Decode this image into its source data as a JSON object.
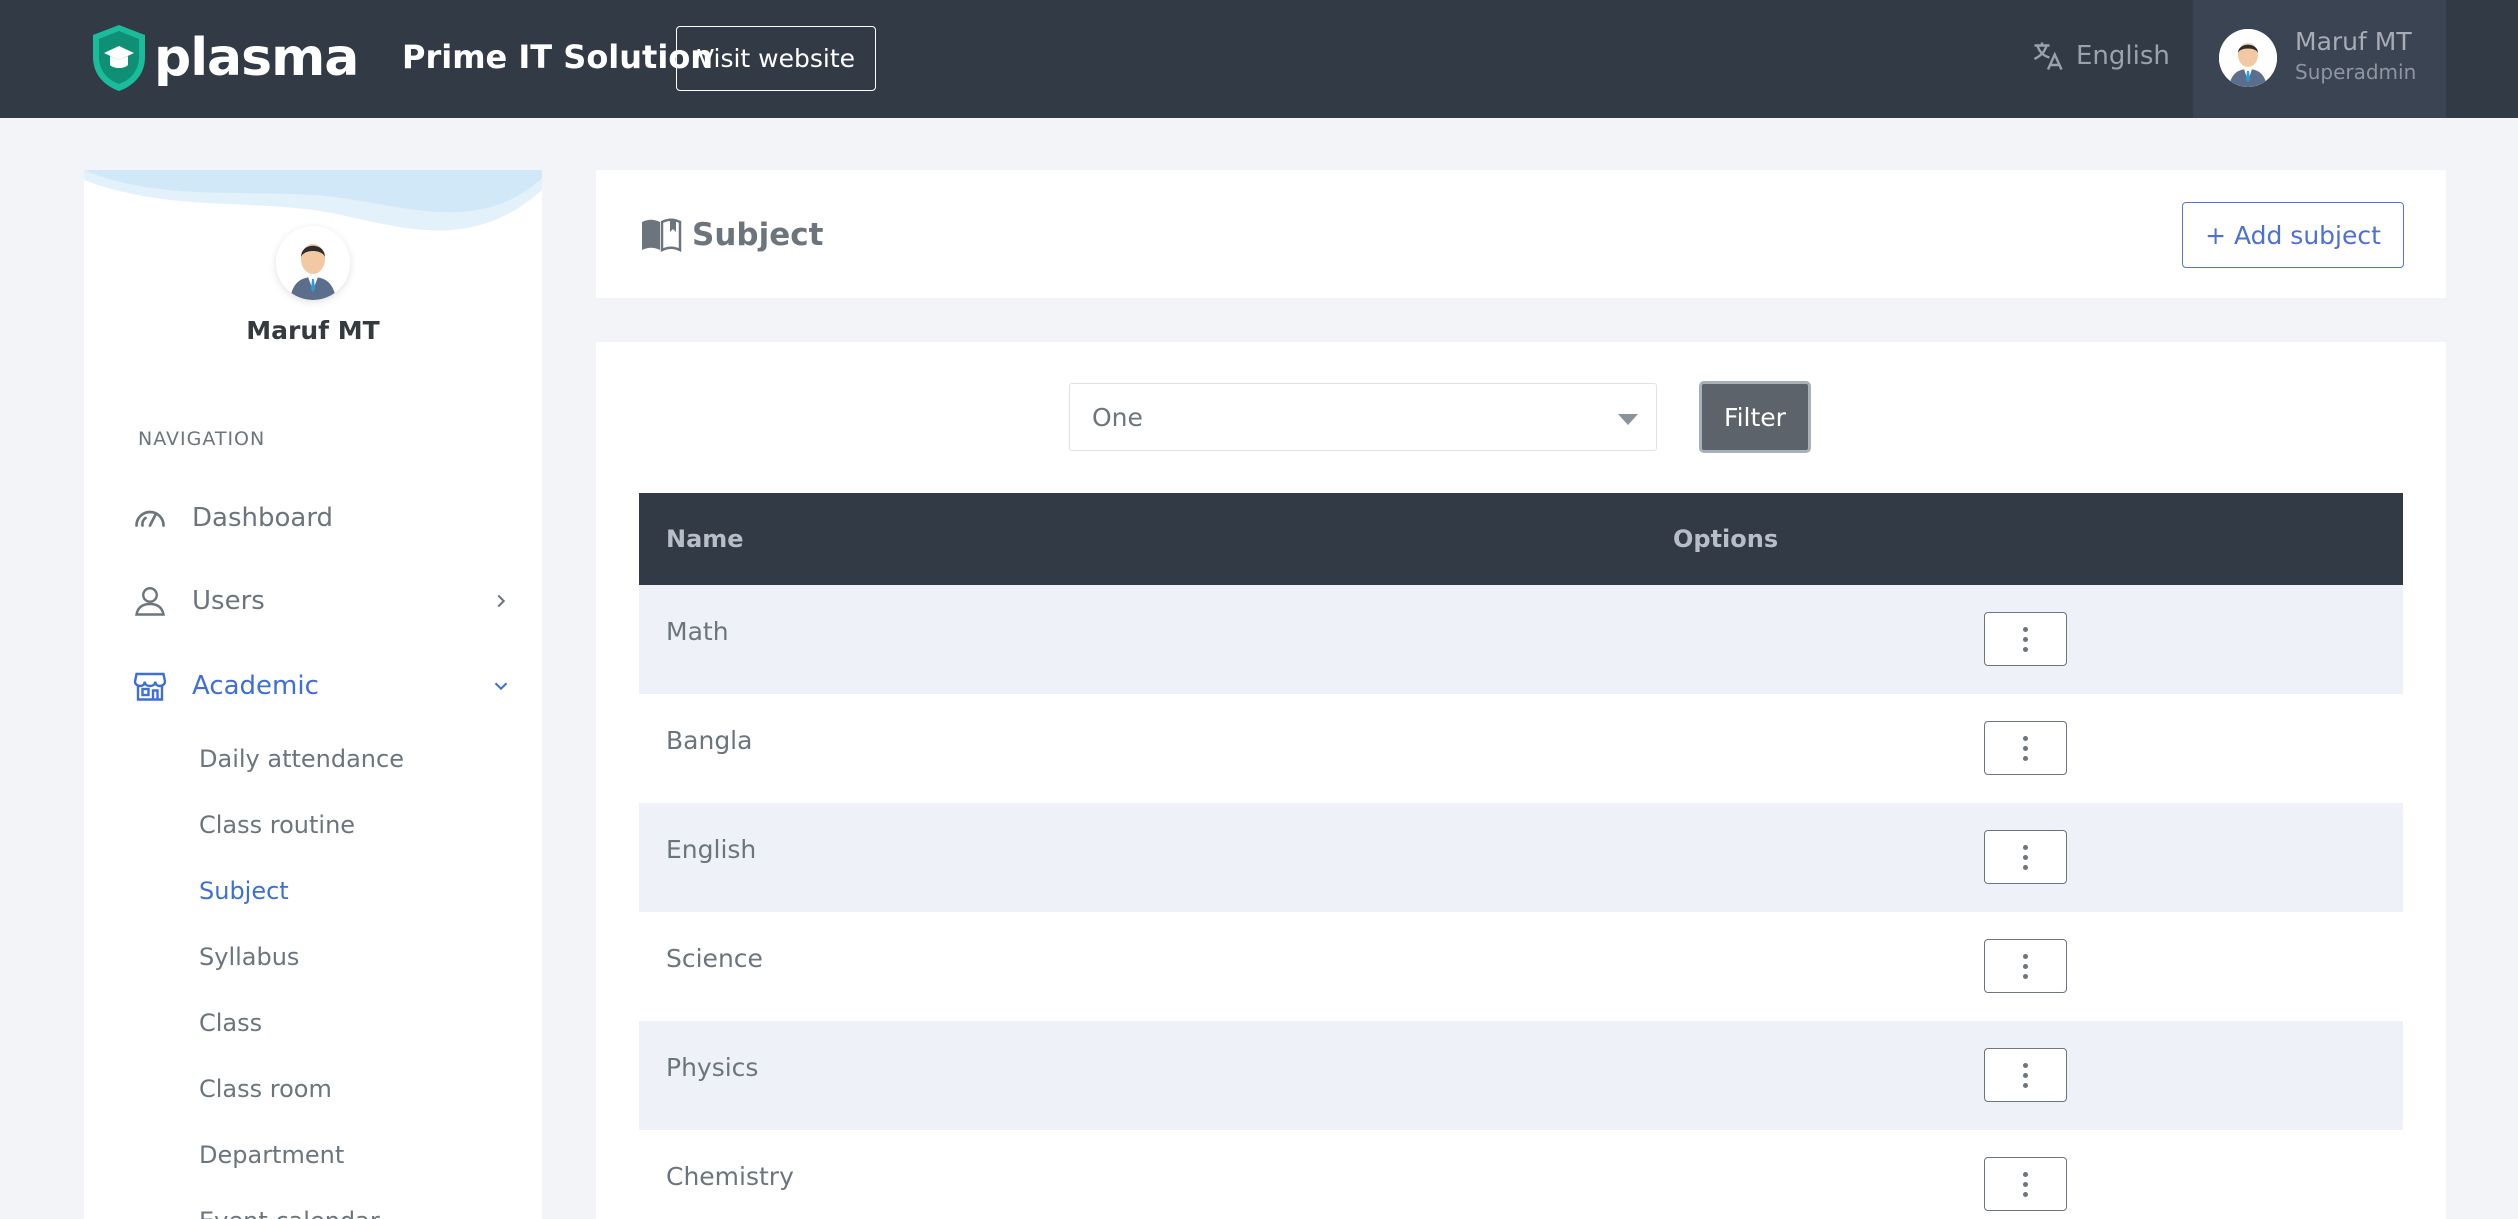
{
  "header": {
    "logo_text": "plasma",
    "org_name": "Prime IT Solution",
    "visit_label": "Visit website",
    "language": "English",
    "user_name": "Maruf MT",
    "user_role": "Superadmin"
  },
  "sidebar": {
    "profile_name": "Maruf MT",
    "nav_title": "NAVIGATION",
    "items": [
      {
        "label": "Dashboard",
        "icon": "speedometer-icon"
      },
      {
        "label": "Users",
        "icon": "user-icon"
      },
      {
        "label": "Academic",
        "icon": "store-icon"
      }
    ],
    "sub_items": [
      "Daily attendance",
      "Class routine",
      "Subject",
      "Syllabus",
      "Class",
      "Class room",
      "Department",
      "Event calendar"
    ]
  },
  "page": {
    "title": "Subject",
    "add_label": "+ Add subject"
  },
  "filter": {
    "selected": "One",
    "button_label": "Filter"
  },
  "table": {
    "headers": [
      "Name",
      "Options"
    ],
    "rows": [
      "Math",
      "Bangla",
      "English",
      "Science",
      "Physics",
      "Chemistry"
    ]
  },
  "colors": {
    "topbar": "#323a46",
    "accent": "#3e6fd6",
    "logo_green": "#1abc9c"
  }
}
